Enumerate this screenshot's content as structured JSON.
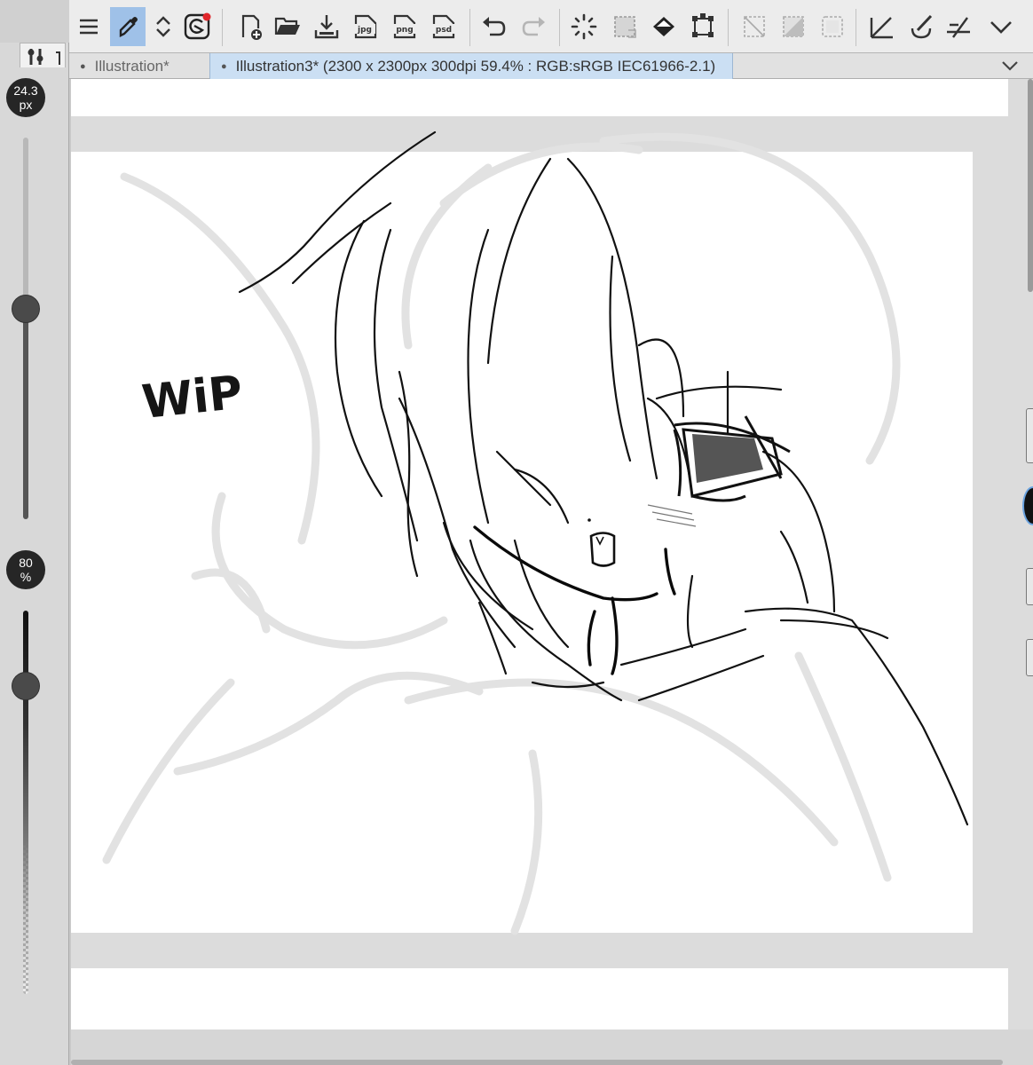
{
  "toolbar": {
    "buttons": [
      {
        "name": "menu-icon"
      },
      {
        "name": "eyedropper-icon",
        "active": true
      },
      {
        "name": "expand-collapse-icon"
      },
      {
        "name": "companion-icon",
        "badge_color": "#e0262b"
      },
      {
        "name": "new-canvas-icon"
      },
      {
        "name": "open-folder-icon"
      },
      {
        "name": "save-icon"
      },
      {
        "name": "export-jpg-icon",
        "label": "jpg"
      },
      {
        "name": "export-png-icon",
        "label": "png"
      },
      {
        "name": "export-psd-icon",
        "label": "psd"
      },
      {
        "name": "undo-icon"
      },
      {
        "name": "redo-icon"
      },
      {
        "name": "loading-spinner-icon"
      },
      {
        "name": "selection-dashed-icon"
      },
      {
        "name": "fill-bucket-icon"
      },
      {
        "name": "transform-icon"
      },
      {
        "name": "clear-selection-icon"
      },
      {
        "name": "fill-selection-icon"
      },
      {
        "name": "deselect-icon"
      },
      {
        "name": "ruler-icon"
      },
      {
        "name": "brush-icon"
      },
      {
        "name": "perspective-ruler-icon"
      },
      {
        "name": "chevron-down-icon"
      }
    ]
  },
  "left_panel": {
    "brush_size_label": "24.3",
    "brush_size_unit": "px",
    "brush_size_level": 0.45,
    "opacity_label": "80",
    "opacity_unit": "%",
    "opacity_level": 0.8
  },
  "tabs": [
    {
      "label": "Illustration*",
      "active": false
    },
    {
      "label": "Illustration3* (2300 x 2300px 300dpi 59.4% : RGB:sRGB IEC61966-2.1)",
      "active": true
    }
  ],
  "canvas": {
    "sketch_text": "WiP",
    "background": "#ffffff",
    "frame_color": "#dcdcdc"
  },
  "colors": {
    "accent": "#9fc1e8",
    "active_tab": "#cbdff3",
    "badge": "#e0262b"
  }
}
